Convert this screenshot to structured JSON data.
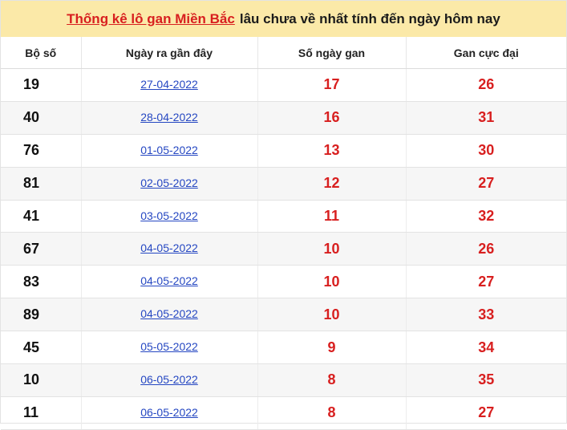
{
  "title": {
    "link_text": "Thống kê lô gan Miền Bắc",
    "rest_text": "lâu chưa về nhất tính đến ngày hôm nay"
  },
  "headers": [
    "Bộ số",
    "Ngày ra gần đây",
    "Số ngày gan",
    "Gan cực đại"
  ],
  "rows": [
    {
      "number": "19",
      "date": "27-04-2022",
      "days": "17",
      "max": "26"
    },
    {
      "number": "40",
      "date": "28-04-2022",
      "days": "16",
      "max": "31"
    },
    {
      "number": "76",
      "date": "01-05-2022",
      "days": "13",
      "max": "30"
    },
    {
      "number": "81",
      "date": "02-05-2022",
      "days": "12",
      "max": "27"
    },
    {
      "number": "41",
      "date": "03-05-2022",
      "days": "11",
      "max": "32"
    },
    {
      "number": "67",
      "date": "04-05-2022",
      "days": "10",
      "max": "26"
    },
    {
      "number": "83",
      "date": "04-05-2022",
      "days": "10",
      "max": "27"
    },
    {
      "number": "89",
      "date": "04-05-2022",
      "days": "10",
      "max": "33"
    },
    {
      "number": "45",
      "date": "05-05-2022",
      "days": "9",
      "max": "34"
    },
    {
      "number": "10",
      "date": "06-05-2022",
      "days": "8",
      "max": "35"
    },
    {
      "number": "11",
      "date": "06-05-2022",
      "days": "8",
      "max": "27"
    }
  ],
  "colors": {
    "title_bg": "#fbe9a8",
    "accent_red": "#d81f1f",
    "link_blue": "#2547c2"
  }
}
